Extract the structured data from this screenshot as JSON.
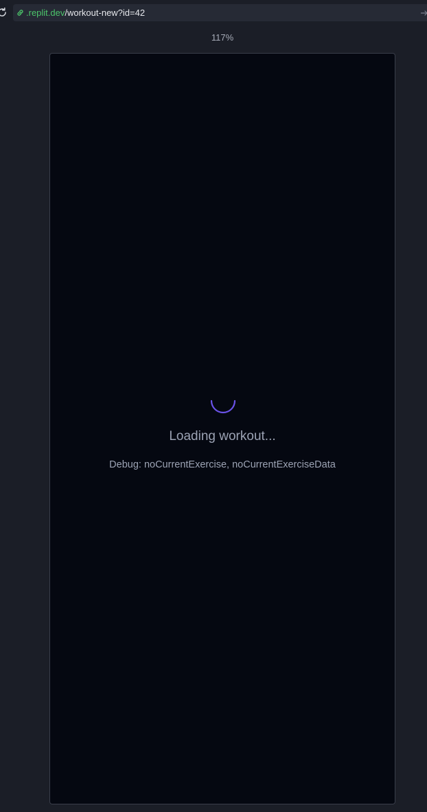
{
  "browser": {
    "url_host": ".replit.dev",
    "url_path": "/workout-new?id=42",
    "zoom": "117%"
  },
  "page": {
    "loading_message": "Loading workout...",
    "debug_message": "Debug: noCurrentExercise, noCurrentExerciseData"
  },
  "icons": {
    "reload": "reload-icon",
    "link": "link-icon",
    "go": "arrow-right-icon",
    "spinner": "loading-spinner"
  },
  "colors": {
    "chrome_background": "#1b1e27",
    "url_bar_background": "#262a35",
    "url_host": "#4cc46a",
    "page_background": "#050811",
    "spinner_accent": "#6a52e8",
    "muted_text": "#9ca3b4"
  }
}
